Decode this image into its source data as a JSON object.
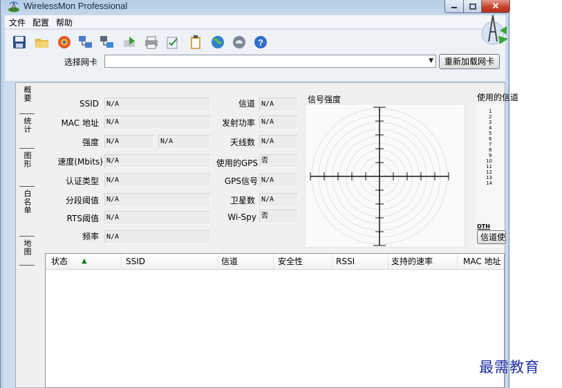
{
  "window": {
    "title": "WirelessMon Professional",
    "icons": {
      "app": "wireless-antenna-icon",
      "minimize": "minimize-icon",
      "maximize": "maximize-icon",
      "close": "close-icon"
    },
    "close_label": "✕"
  },
  "menu": {
    "items": [
      {
        "label": "文件"
      },
      {
        "label": "配置"
      },
      {
        "label": "帮助"
      }
    ]
  },
  "toolbar": {
    "icons": [
      "save-icon",
      "open-folder-icon",
      "record-icon",
      "network-graph-icon",
      "network-graph-2-icon",
      "export-icon",
      "print-icon",
      "check-report-icon",
      "clipboard-icon",
      "globe-icon",
      "cloud-icon",
      "help-icon"
    ],
    "nic_label": "选择网卡",
    "nic_value": "",
    "reload_label": "重新加载网卡",
    "logo": "wirelessmon-logo"
  },
  "tabs": [
    {
      "label": "概要",
      "selected": true
    },
    {
      "label": "统计"
    },
    {
      "label": "图形"
    },
    {
      "label": "白名单"
    },
    {
      "label": "地图"
    }
  ],
  "fields_left": [
    {
      "label": "SSID",
      "value": "N/A"
    },
    {
      "label": "MAC 地址",
      "value": "N/A"
    },
    {
      "label": "强度",
      "value": "N/A",
      "value2": "N/A"
    },
    {
      "label": "速度(Mbits)",
      "value": "N/A"
    },
    {
      "label": "认证类型",
      "value": "N/A"
    },
    {
      "label": "分段阈值",
      "value": "N/A"
    },
    {
      "label": "RTS阈值",
      "value": "N/A"
    },
    {
      "label": "频率",
      "value": "N/A"
    }
  ],
  "fields_right": [
    {
      "label": "信道",
      "value": "N/A"
    },
    {
      "label": "发射功率",
      "value": "N/A"
    },
    {
      "label": "天线数",
      "value": "N/A"
    },
    {
      "label": "使用的GPS",
      "value": "否"
    },
    {
      "label": "GPS信号",
      "value": "N/A"
    },
    {
      "label": "卫星数",
      "value": "N/A"
    },
    {
      "label": "Wi-Spy",
      "value": "否"
    }
  ],
  "signal": {
    "title": "信号强度"
  },
  "channels": {
    "title": "使用的信道",
    "numbers": [
      "1",
      "2",
      "3",
      "4",
      "5",
      "6",
      "7",
      "8",
      "9",
      "10",
      "11",
      "12",
      "13",
      "14"
    ],
    "other": "OTH",
    "button_label": "信道使用"
  },
  "list": {
    "columns": [
      "状态",
      "SSID",
      "信道",
      "安全性",
      "RSSI",
      "支持的速率",
      "MAC 地址"
    ],
    "sort_indicator": "▲",
    "rows": []
  },
  "watermark": "最需教育"
}
